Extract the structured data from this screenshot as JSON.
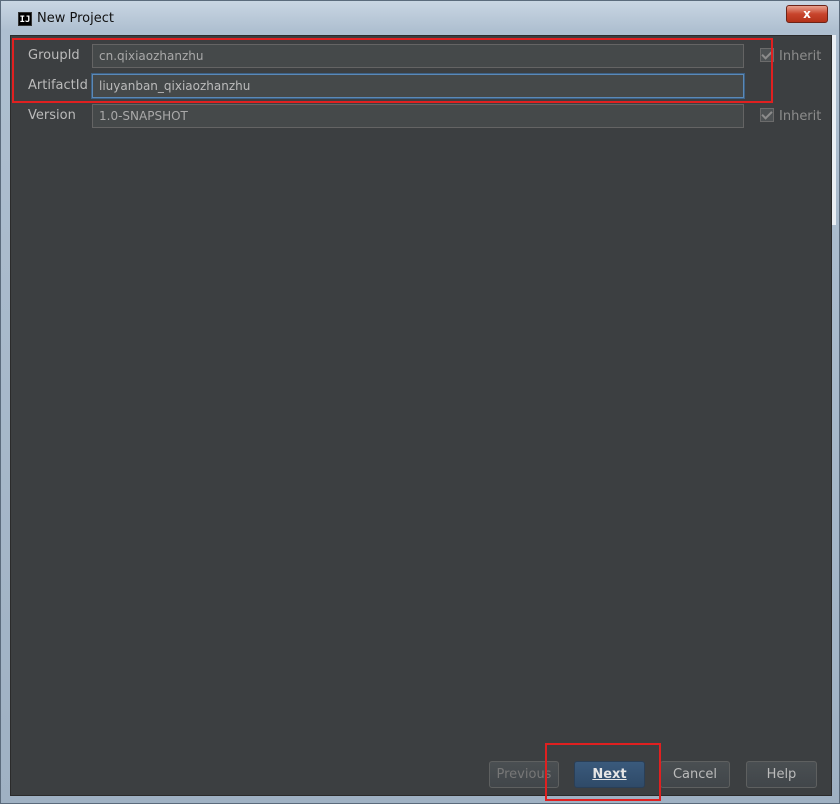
{
  "window": {
    "title": "New Project",
    "app_icon_text": "IJ",
    "close_label": "x"
  },
  "form": {
    "group_id": {
      "label": "GroupId",
      "value": "cn.qixiaozhanzhu",
      "inherit_label": "Inherit",
      "inherit_checked": true
    },
    "artifact_id": {
      "label": "ArtifactId",
      "value": "liuyanban_qixiaozhanzhu"
    },
    "version": {
      "label": "Version",
      "value": "1.0-SNAPSHOT",
      "inherit_label": "Inherit",
      "inherit_checked": true
    }
  },
  "buttons": {
    "previous": "Previous",
    "next": "Next",
    "cancel": "Cancel",
    "help": "Help"
  },
  "colors": {
    "panel_bg": "#3c3f41",
    "highlight": "#e02020",
    "default_button": "#2f4a68"
  }
}
